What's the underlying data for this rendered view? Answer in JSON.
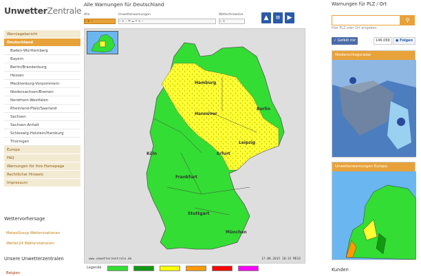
{
  "site": {
    "logo_bold": "Unwetter",
    "logo_light": "Zentrale"
  },
  "nav": {
    "items_top": [
      "Warnlagebericht"
    ],
    "active": "Deutschland",
    "subs": [
      "Baden-Württemberg",
      "Bayern",
      "Berlin/Brandenburg",
      "Hessen",
      "Mecklenburg-Vorpommern",
      "Niedersachsen/Bremen",
      "Nordrhein-Westfalen",
      "Rheinland-Pfalz/Saarland",
      "Sachsen",
      "Sachsen-Anhalt",
      "Schleswig-Holstein/Hamburg",
      "Thüringen"
    ],
    "items_bottom": [
      "Europa",
      "FAQ",
      "Warnungen für Ihre Homepage",
      "Rechtlicher Hinweis",
      "Impressum"
    ]
  },
  "forecast": {
    "heading": "Wettervorhersage",
    "links": [
      "MeteoGroup Wetterstationen",
      "Wetter24 Wetterstationen"
    ]
  },
  "ours": {
    "heading": "Unsere Unwetterzentralen",
    "links": [
      "Belgien"
    ]
  },
  "center": {
    "title": "Alle Warnungen für Deutschland",
    "filters": {
      "alle": "Alle",
      "unwetter": "Unwetterwarnungen",
      "wetter": "Wetterhinweise"
    },
    "map_credit": "www.unwetterzentrale.de",
    "map_timestamp": "17.08.2015 10:32 MESZ",
    "cities": [
      "Hamburg",
      "Berlin",
      "Hannover",
      "Leipzig",
      "Köln",
      "Erfurt",
      "Frankfurt",
      "Stuttgart",
      "München"
    ],
    "legend_label": "Legende",
    "legend_colors": [
      "#33dd33",
      "#119911",
      "#ffff00",
      "#ff9900",
      "#ff0000",
      "#ff00ff"
    ]
  },
  "right": {
    "warn_heading": "Warnungen für PLZ / Ort",
    "search_placeholder": "",
    "search_hint": "Hier PLZ oder Ort eingeben",
    "fb_like": "Gefällt mir",
    "fb_count": "146.069",
    "tw_follow": "Folgen",
    "radar_title": "Niederschlagsradar",
    "europe_title": "Unwetterwarnungen Europa",
    "kunden": "Kunden"
  },
  "colors": {
    "accent": "#e8a23a",
    "green": "#33dd33",
    "yellow": "#ffff00"
  }
}
